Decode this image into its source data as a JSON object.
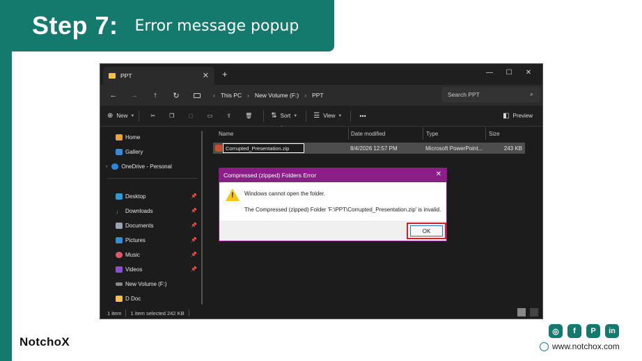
{
  "banner": {
    "step": "Step 7:",
    "title": "Error message popup"
  },
  "explorer": {
    "tab_label": "PPT",
    "tab_close": "✕",
    "new_tab": "+",
    "window_controls": {
      "minimize": "—",
      "maximize": "☐",
      "close": "✕"
    },
    "nav": {
      "back": "←",
      "forward": "→",
      "up": "↑",
      "refresh": "↻"
    },
    "breadcrumb": [
      "This PC",
      "New Volume (F:)",
      "PPT"
    ],
    "breadcrumb_sep": "›",
    "search_placeholder": "Search PPT",
    "toolbar": {
      "new": "New",
      "sort": "Sort",
      "view": "View",
      "more": "•••",
      "preview": "Preview"
    },
    "sidebar": {
      "home": "Home",
      "gallery": "Gallery",
      "onedrive": "OneDrive - Personal",
      "desktop": "Desktop",
      "downloads": "Downloads",
      "documents": "Documents",
      "pictures": "Pictures",
      "music": "Music",
      "videos": "Videos",
      "new_volume": "New Volume (F:)",
      "d_doc": "D Doc"
    },
    "columns": {
      "name": "Name",
      "date": "Date modified",
      "type": "Type",
      "size": "Size"
    },
    "file": {
      "name": "Corrupted_Presentation.zip",
      "date": "8/4/2026 12:57 PM",
      "type": "Microsoft PowerPoint...",
      "size": "243 KB"
    },
    "status": {
      "items": "1 item",
      "selected": "1 item selected  242 KB"
    }
  },
  "dialog": {
    "title": "Compressed (zipped) Folders Error",
    "close": "✕",
    "message1": "Windows cannot open the folder.",
    "message2": "The Compressed (zipped) Folder 'F:\\PPT\\Corrupted_Presentation.zip' is invalid.",
    "ok_label": "OK"
  },
  "footer": {
    "logo": "NotchoX",
    "website": "www.notchox.com",
    "social_icons": [
      "instagram-icon",
      "facebook-icon",
      "pinterest-icon",
      "linkedin-icon"
    ]
  },
  "colors": {
    "brand": "#157a6e",
    "dialog_title": "#8c1e88",
    "highlight": "#d0202a"
  }
}
